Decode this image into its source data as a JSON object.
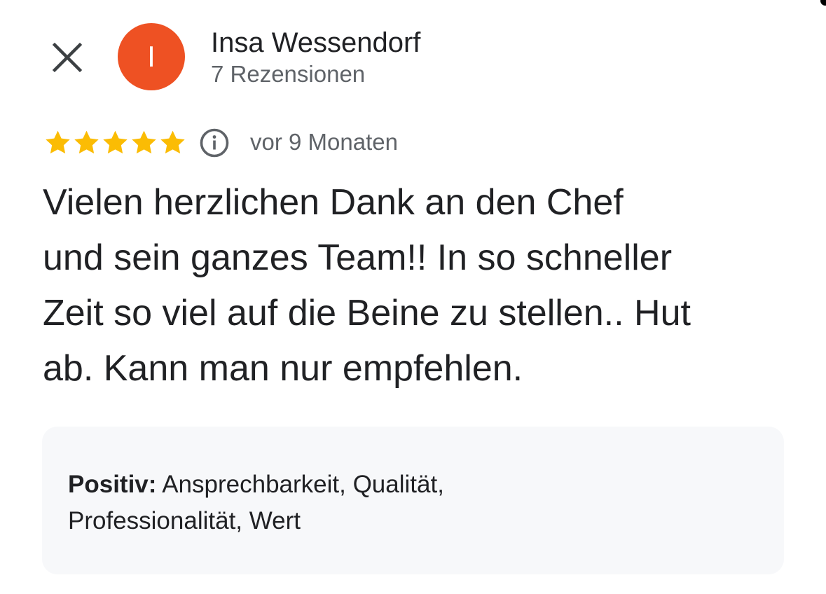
{
  "header": {
    "close_icon": "close-icon",
    "avatar_initial": "I",
    "avatar_color": "#ee5123",
    "reviewer_name": "Insa Wessendorf",
    "review_count": "7 Rezensionen"
  },
  "review": {
    "rating": 5,
    "max_rating": 5,
    "star_color": "#fbbc04",
    "info_icon": "info-icon",
    "date": "vor 9 Monaten",
    "text_lines": [
      "Vielen herzlichen Dank an den Chef",
      "und sein ganzes Team!! In so schneller",
      "Zeit so viel auf die Beine zu stellen.. Hut",
      "ab. Kann man nur empfehlen."
    ]
  },
  "attributes": {
    "label": "Positiv:",
    "values_line1": " Ansprechbarkeit, Qualität,",
    "values_line2": "Professionalität, Wert"
  }
}
